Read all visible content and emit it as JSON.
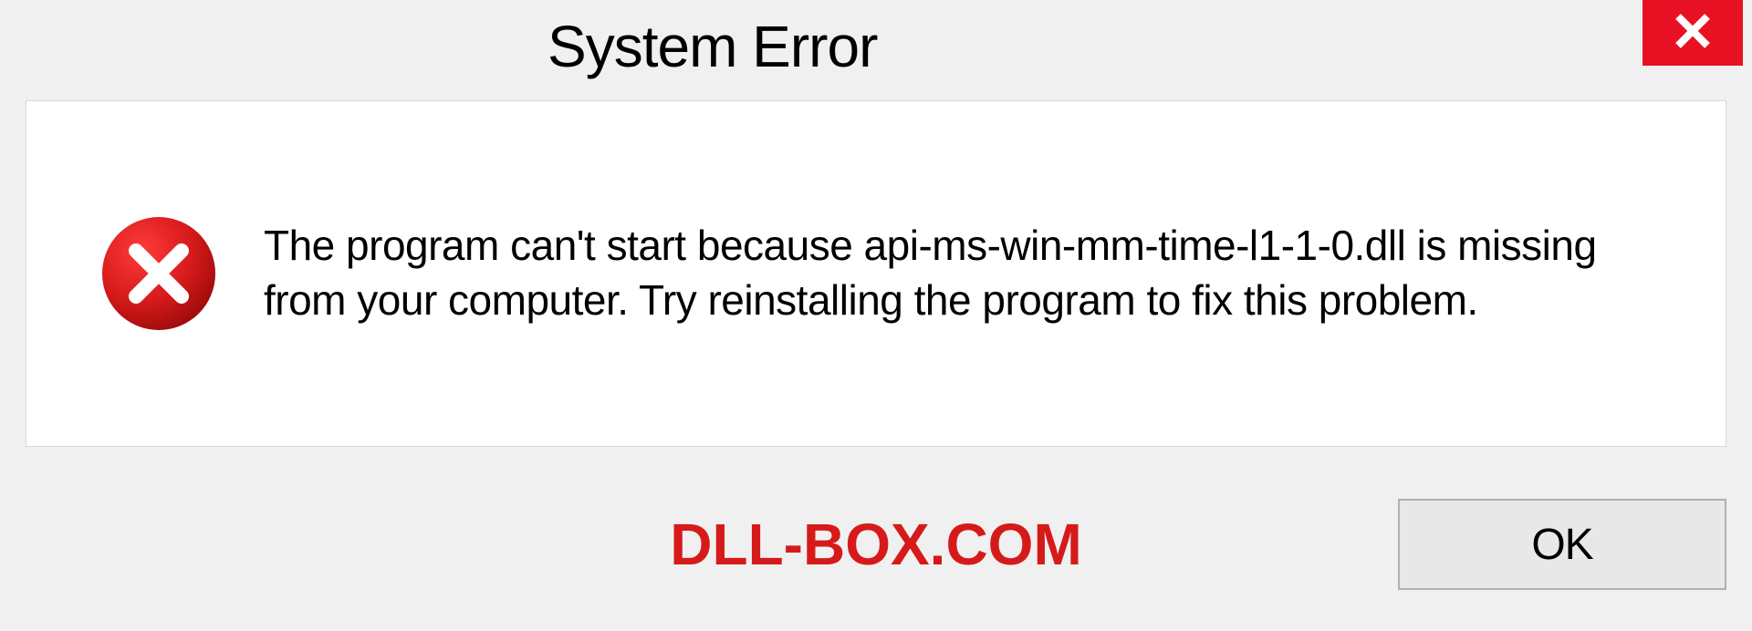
{
  "dialog": {
    "title": "System Error",
    "message": "The program can't start because api-ms-win-mm-time-l1-1-0.dll is missing from your computer. Try reinstalling the program to fix this problem.",
    "ok_label": "OK"
  },
  "watermark": "DLL-BOX.COM",
  "colors": {
    "close_bg": "#e81123",
    "error_icon": "#d61a1a",
    "watermark": "#d61a1a"
  }
}
